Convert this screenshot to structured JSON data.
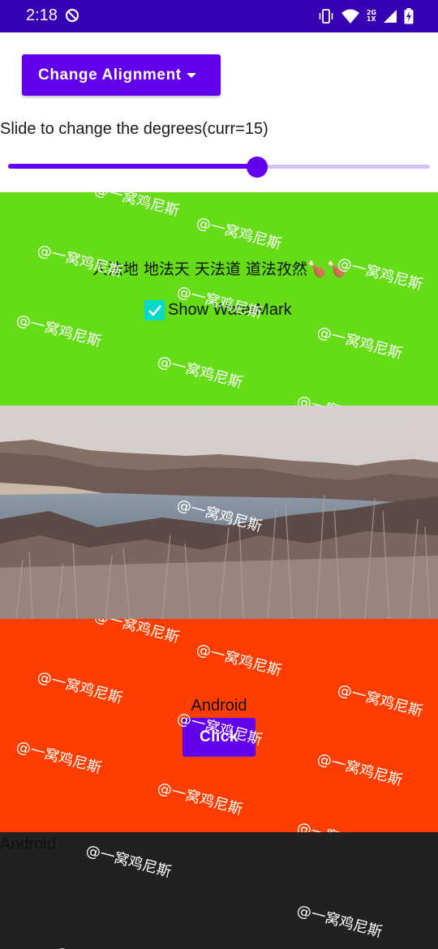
{
  "status_bar": {
    "time": "2:18",
    "network_top": "2G",
    "network_bottom": "1X"
  },
  "controls": {
    "alignment_button_label": "Change Alignment",
    "slider_label": "Slide to change the degrees(curr=15)",
    "slider_value_fraction": 0.59
  },
  "watermark": {
    "text": "@一窝鸡尼斯"
  },
  "green_section": {
    "poem": "人法地 地法天 天法道 道法孜然🍗🍗",
    "checkbox_label": "Show WaterMark",
    "checkbox_checked": true
  },
  "red_section": {
    "text": "Android",
    "button_label": "Click"
  },
  "dark_section": {
    "text": "Android"
  },
  "colors": {
    "primary": "#6200ee",
    "status_bar": "#3700b3",
    "green": "#64dd17",
    "red": "#ff3d00",
    "dark": "#212121",
    "checkbox": "#03dac5"
  }
}
